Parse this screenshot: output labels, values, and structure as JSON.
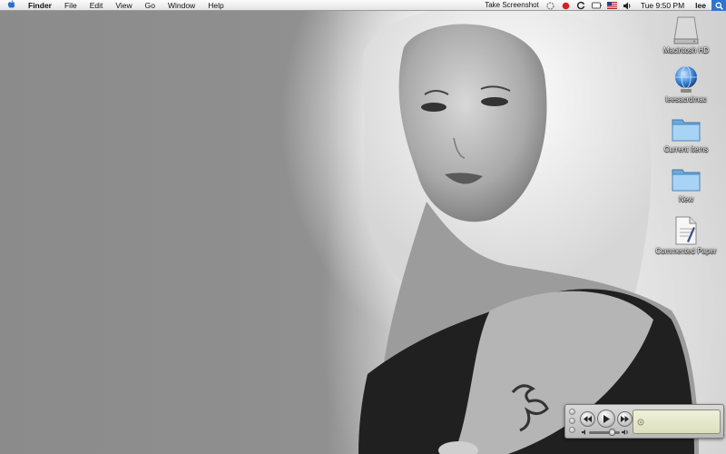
{
  "menubar": {
    "apple_icon": "apple-icon",
    "app_name": "Finder",
    "menus": [
      "File",
      "Edit",
      "View",
      "Go",
      "Window",
      "Help"
    ],
    "status_text": "Take Screenshot",
    "clock": "Tue 9:50 PM",
    "user": "lee"
  },
  "desktop_icons": [
    {
      "label": "Macintosh HD",
      "icon": "hard-drive-icon"
    },
    {
      "label": "leesacrdmac",
      "icon": "network-globe-icon"
    },
    {
      "label": "Current Items",
      "icon": "folder-icon"
    },
    {
      "label": "New",
      "icon": "folder-icon"
    },
    {
      "label": "Commented Paper",
      "icon": "document-icon"
    }
  ],
  "miniplayer": {
    "volume_level": 0.75
  },
  "colors": {
    "menubar": "#ececec",
    "spotlight": "#2f74d0",
    "record_red": "#d42020",
    "folder_blue": "#8fc3ec"
  }
}
